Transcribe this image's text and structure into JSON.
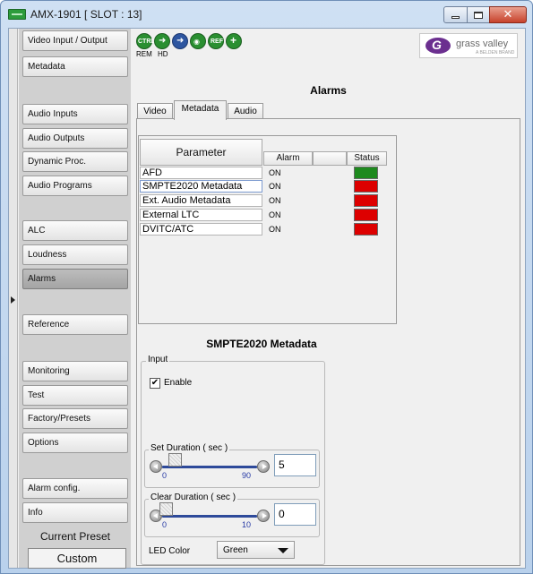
{
  "window": {
    "title": "AMX-1901 [ SLOT : 13]"
  },
  "nav": {
    "items": [
      {
        "label": "Video Input / Output",
        "active": false
      },
      {
        "label": "Metadata",
        "active": false
      },
      {
        "label": "Audio Inputs",
        "active": false
      },
      {
        "label": "Audio Outputs",
        "active": false
      },
      {
        "label": "Dynamic Proc.",
        "active": false
      },
      {
        "label": "Audio Programs",
        "active": false
      },
      {
        "label": "ALC",
        "active": false
      },
      {
        "label": "Loudness",
        "active": false
      },
      {
        "label": "Alarms",
        "active": true
      },
      {
        "label": "Reference",
        "active": false
      },
      {
        "label": "Monitoring",
        "active": false
      },
      {
        "label": "Test",
        "active": false
      },
      {
        "label": "Factory/Presets",
        "active": false
      },
      {
        "label": "Options",
        "active": false
      },
      {
        "label": "Alarm config.",
        "active": false
      },
      {
        "label": "Info",
        "active": false
      }
    ],
    "current_preset_label": "Current Preset",
    "current_preset_value": "Custom"
  },
  "status_icons": {
    "ctrl": "CTRL",
    "rem": "REM",
    "hd": "HD",
    "ref": "REF"
  },
  "logo": {
    "text": "grass valley",
    "sub": "A BELDEN BRAND"
  },
  "section_title": "Alarms",
  "tabs": [
    {
      "label": "Video",
      "active": false
    },
    {
      "label": "Metadata",
      "active": true
    },
    {
      "label": "Audio",
      "active": false
    }
  ],
  "table": {
    "headers": {
      "parameter": "Parameter",
      "alarm": "Alarm",
      "status": "Status"
    },
    "rows": [
      {
        "parameter": "AFD",
        "alarm": "ON",
        "status_color": "#1e8a1e"
      },
      {
        "parameter": "SMPTE2020 Metadata",
        "alarm": "ON",
        "status_color": "#dd0000"
      },
      {
        "parameter": "Ext. Audio Metadata",
        "alarm": "ON",
        "status_color": "#dd0000"
      },
      {
        "parameter": "External LTC",
        "alarm": "ON",
        "status_color": "#dd0000"
      },
      {
        "parameter": "DVITC/ATC",
        "alarm": "ON",
        "status_color": "#dd0000"
      }
    ]
  },
  "detail": {
    "title": "SMPTE2020 Metadata",
    "input_legend": "Input",
    "enable_label": "Enable",
    "enable_checked": "✔",
    "set_duration": {
      "legend": "Set Duration ( sec )",
      "min": "0",
      "max": "90",
      "value": "5"
    },
    "clear_duration": {
      "legend": "Clear Duration ( sec )",
      "min": "0",
      "max": "10",
      "value": "0"
    },
    "led_color_label": "LED Color",
    "led_color_value": "Green"
  }
}
